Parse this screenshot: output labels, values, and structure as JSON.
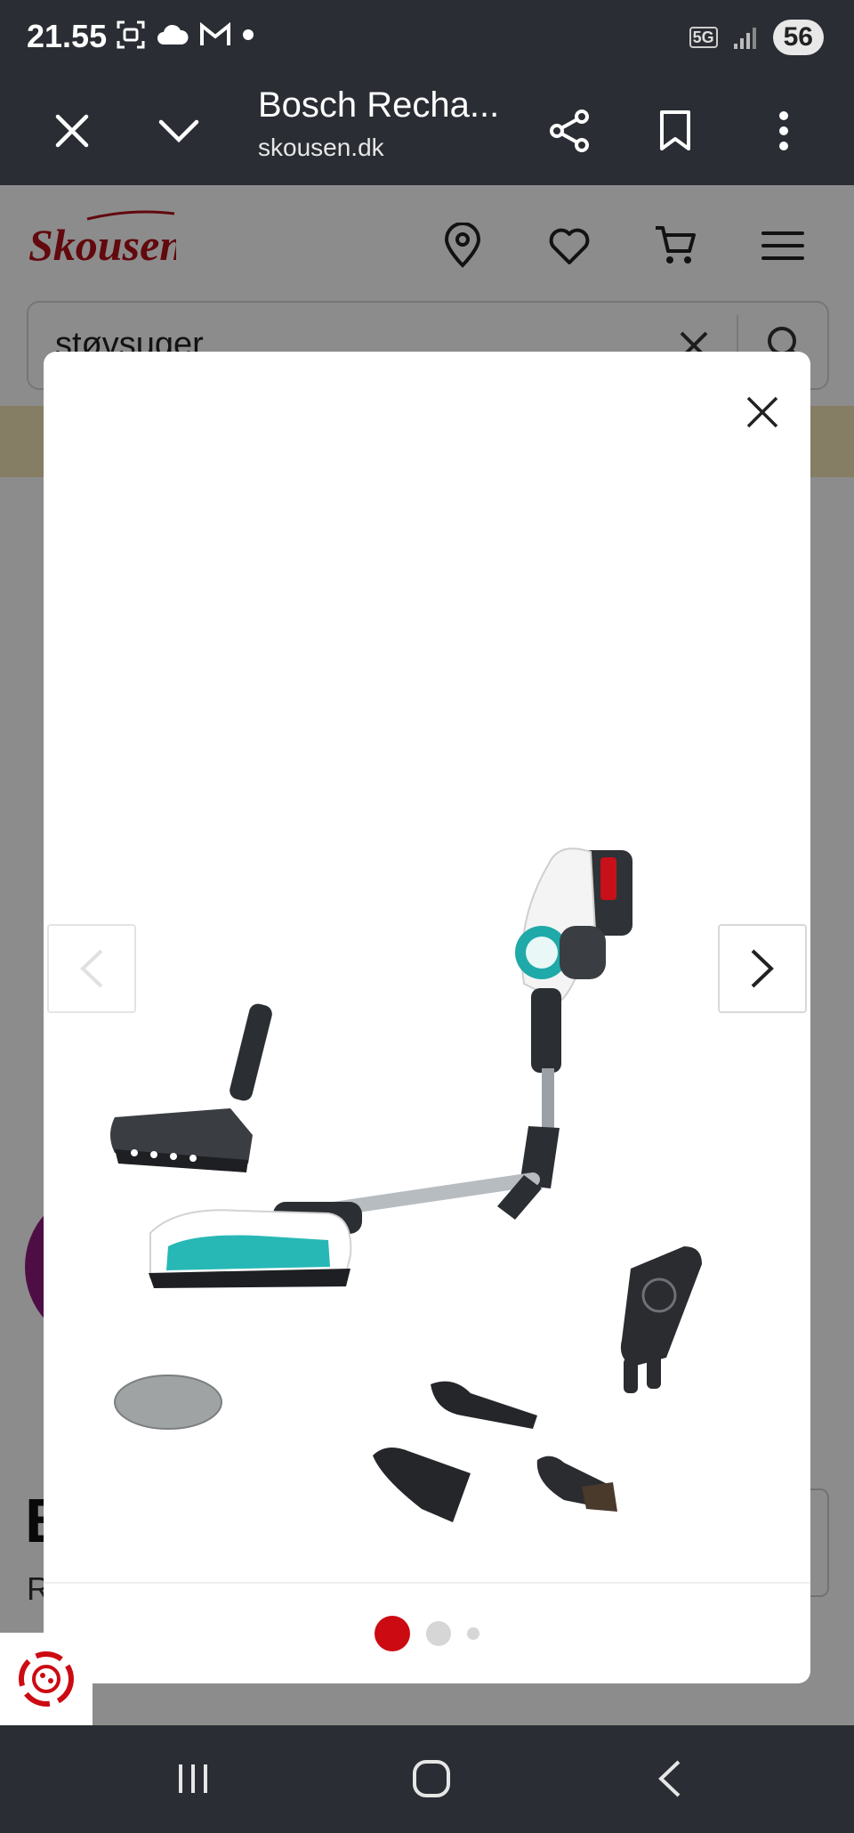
{
  "status_bar": {
    "time": "21.55",
    "network": "5G",
    "battery": "56",
    "left_icons": [
      "screenshot-icon",
      "cloud-icon",
      "gmail-icon",
      "dot-icon"
    ]
  },
  "browser": {
    "title": "Bosch Recha...",
    "url": "skousen.dk"
  },
  "site": {
    "logo_text": "Skousen",
    "search_value": "støvsuger",
    "background_heading_initial": "B",
    "background_subtitle_initial": "R"
  },
  "gallery": {
    "total_images": 3,
    "current_index": 1
  },
  "colors": {
    "brand_red": "#cc0a12",
    "bosch_teal": "#1fa9a9",
    "dark_chrome": "#2a2d33"
  }
}
